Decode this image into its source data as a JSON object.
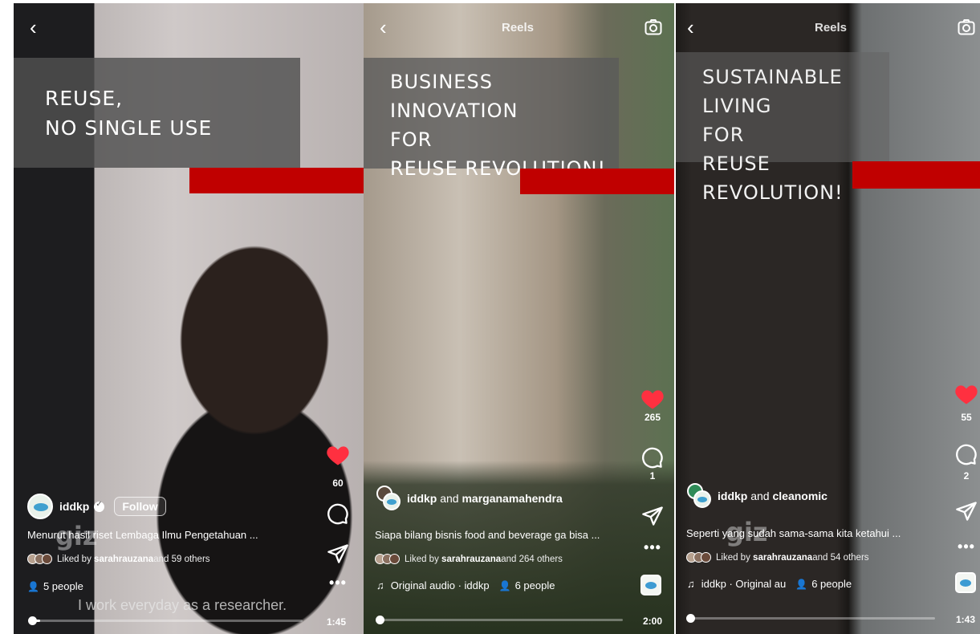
{
  "panels": [
    {
      "title": "REUSE,\nNO SINGLE USE",
      "header": {
        "back_icon": "chevron-left"
      },
      "likes": "60",
      "author": "iddkp",
      "follow_label": "Follow",
      "caption": "Menurut hasil riset Lembaga Ilmu Pengetahuan ...",
      "liked_by_prefix": "Liked by ",
      "liked_by_user": "sarahrauzana",
      "liked_by_suffix": " and 59 others",
      "people": "5 people",
      "subtitle": "I work everyday as a researcher.",
      "watermark": "giz",
      "time": "1:45",
      "progress": 0.04
    },
    {
      "header": {
        "title": "Reels"
      },
      "title": "BUSINESS INNOVATION\nFOR\nREUSE REVOLUTION!",
      "likes": "265",
      "comments": "1",
      "author": "iddkp",
      "and_label": " and ",
      "coauthor": "marganamahendra",
      "caption": "Siapa bilang bisnis food and beverage ga bisa ...",
      "liked_by_prefix": "Liked by ",
      "liked_by_user": "sarahrauzana",
      "liked_by_suffix": " and 264 others",
      "audio": "Original audio · iddkp",
      "people": "6 people",
      "time": "2:00",
      "progress": 0.03
    },
    {
      "header": {
        "title": "Reels"
      },
      "title": "SUSTAINABLE LIVING\nFOR\nREUSE REVOLUTION!",
      "likes": "55",
      "comments": "2",
      "author": "iddkp",
      "and_label": " and ",
      "coauthor": "cleanomic",
      "caption": "Seperti yang sudah sama-sama kita ketahui ...",
      "liked_by_prefix": "Liked by ",
      "liked_by_user": "sarahrauzana",
      "liked_by_suffix": " and 54 others",
      "audio": "iddkp · Original au",
      "people": "6 people",
      "watermark": "giz",
      "time": "1:43",
      "progress": 0.03
    }
  ],
  "colors": {
    "accent_red": "#c00000",
    "heart_red": "#ff3040"
  }
}
